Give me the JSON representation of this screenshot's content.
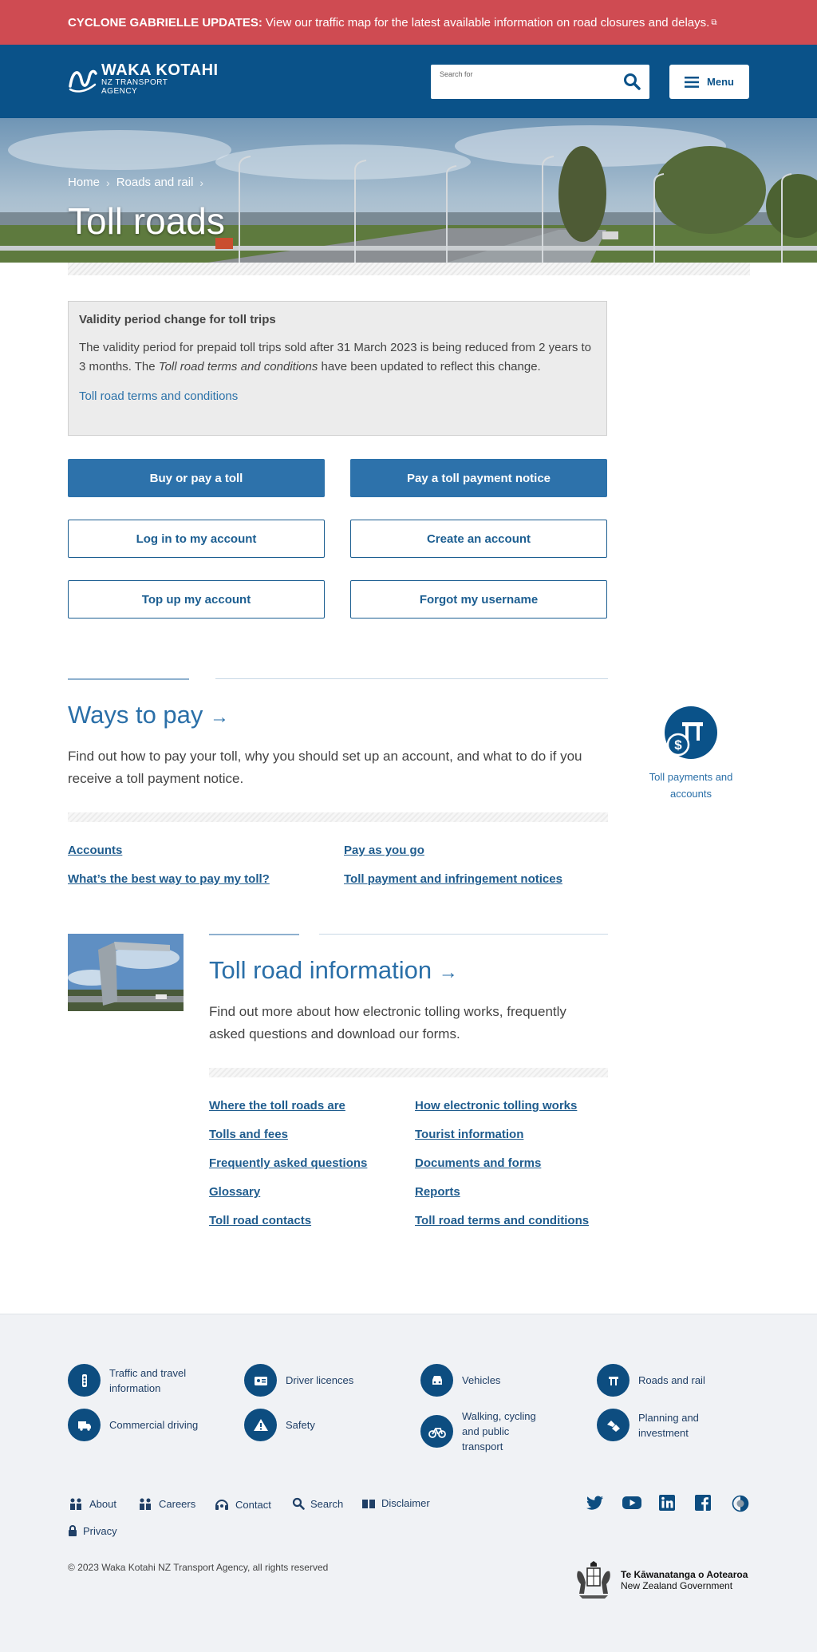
{
  "alert": {
    "strong": "CYCLONE GABRIELLE UPDATES:",
    "text": "View our traffic map for the latest available information on road closures and delays."
  },
  "header": {
    "logo_main": "WAKA KOTAHI",
    "logo_sub1": "NZ TRANSPORT",
    "logo_sub2": "AGENCY",
    "search_placeholder": "Search for",
    "menu_label": "Menu"
  },
  "hero": {
    "breadcrumb": [
      "Home",
      "Roads and rail"
    ],
    "title": "Toll roads"
  },
  "notice": {
    "heading": "Validity period change for toll trips",
    "body_1": "The validity period for prepaid toll trips sold after 31 March 2023 is being reduced from 2 years to 3 months. The ",
    "body_em": "Toll road terms and conditions",
    "body_2": " have been updated to reflect this change.",
    "link": "Toll road terms and conditions"
  },
  "actions": {
    "buy": "Buy or pay a toll",
    "pay_notice": "Pay a toll payment notice",
    "login": "Log in to my account",
    "create": "Create an account",
    "topup": "Top up my account",
    "forgot": "Forgot my username"
  },
  "ways": {
    "title": "Ways to pay",
    "arrow": "→",
    "desc": "Find out how to pay your toll, why you should set up an account, and what to do if you receive a toll payment notice.",
    "links": [
      "Accounts",
      "Pay as you go",
      "What’s the best way to pay my toll?",
      "Toll payment and infringement notices"
    ],
    "side_label": "Toll payments and accounts"
  },
  "info": {
    "title": "Toll road information",
    "arrow": "→",
    "desc": "Find out more about how electronic tolling works, frequently asked questions and download our forms.",
    "links_left": [
      "Where the toll roads are",
      "Tolls and fees",
      "Frequently asked questions",
      "Glossary",
      "Toll road contacts"
    ],
    "links_right": [
      "How electronic tolling works",
      "Tourist information",
      "Documents and forms",
      "Reports",
      "Toll road terms and conditions"
    ]
  },
  "footer": {
    "categories": [
      "Traffic and travel information",
      "Driver licences",
      "Vehicles",
      "Roads and rail",
      "Commercial driving",
      "Safety",
      "Walking, cycling and public transport",
      "Planning and investment"
    ],
    "links": [
      "About",
      "Careers",
      "Contact",
      "Search",
      "Disclaimer",
      "Privacy"
    ],
    "copyright": "© 2023 Waka Kotahi NZ Transport Agency, all rights reserved",
    "govt_1": "Te Kāwanatanga o Aotearoa",
    "govt_2": "New Zealand Government"
  },
  "colors": {
    "alert": "#cf4b52",
    "header": "#0a5289",
    "accent": "#2d72ab",
    "footer_bg": "#f0f2f5"
  }
}
